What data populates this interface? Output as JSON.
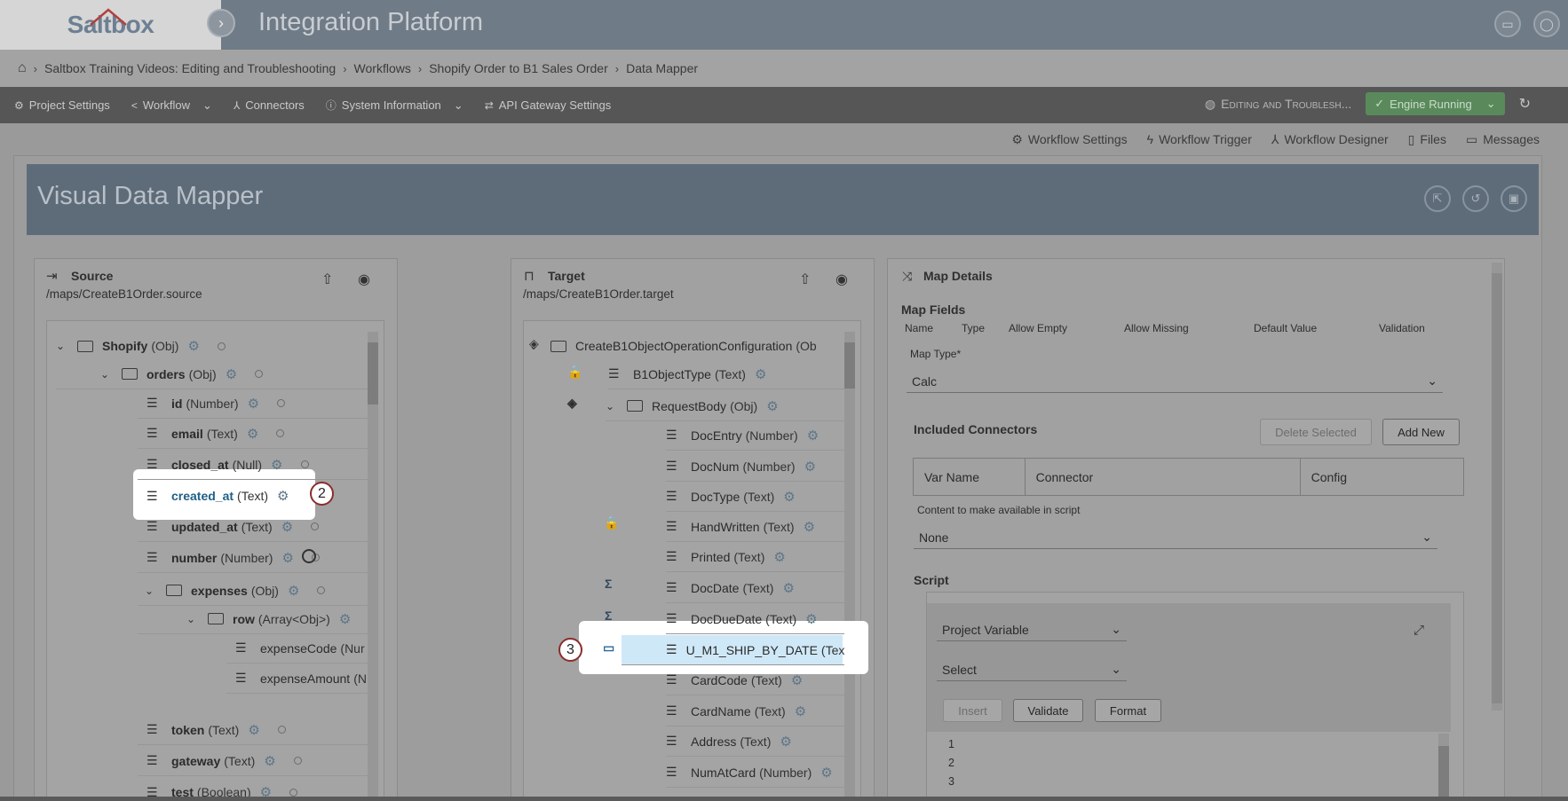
{
  "header": {
    "logo": "Saltbox",
    "title": "Integration Platform"
  },
  "breadcrumb": [
    "Saltbox Training Videos: Editing and Troubleshooting",
    "Workflows",
    "Shopify Order to B1 Sales Order",
    "Data Mapper"
  ],
  "toolbar": {
    "project_settings": "Project Settings",
    "workflow": "Workflow",
    "connectors": "Connectors",
    "system_information": "System Information",
    "api_gateway": "API Gateway Settings",
    "project_name": "Editing and Troublesh...",
    "engine_status": "Engine Running"
  },
  "subbar": {
    "workflow_settings": "Workflow Settings",
    "workflow_trigger": "Workflow Trigger",
    "workflow_designer": "Workflow Designer",
    "files": "Files",
    "messages": "Messages"
  },
  "page_title": "Visual Data Mapper",
  "source": {
    "title": "Source",
    "path": "/maps/CreateB1Order.source",
    "rows": [
      {
        "name": "Shopify",
        "type": "(Obj)"
      },
      {
        "name": "orders",
        "type": "(Obj)"
      },
      {
        "name": "id",
        "type": "(Number)"
      },
      {
        "name": "email",
        "type": "(Text)"
      },
      {
        "name": "closed_at",
        "type": "(Null)"
      },
      {
        "name": "created_at",
        "type": "(Text)"
      },
      {
        "name": "updated_at",
        "type": "(Text)"
      },
      {
        "name": "number",
        "type": "(Number)"
      },
      {
        "name": "expenses",
        "type": "(Obj)"
      },
      {
        "name": "row",
        "type": "(Array<Obj>)"
      },
      {
        "name": "expenseCode",
        "type": "(Nur"
      },
      {
        "name": "expenseAmount",
        "type": "(N"
      },
      {
        "name": "token",
        "type": "(Text)"
      },
      {
        "name": "gateway",
        "type": "(Text)"
      },
      {
        "name": "test",
        "type": "(Boolean)"
      }
    ]
  },
  "target": {
    "title": "Target",
    "path": "/maps/CreateB1Order.target",
    "rows": [
      {
        "name": "CreateB1ObjectOperationConfiguration",
        "type": "(Ob"
      },
      {
        "name": "B1ObjectType",
        "type": "(Text)"
      },
      {
        "name": "RequestBody",
        "type": "(Obj)"
      },
      {
        "name": "DocEntry",
        "type": "(Number)"
      },
      {
        "name": "DocNum",
        "type": "(Number)"
      },
      {
        "name": "DocType",
        "type": "(Text)"
      },
      {
        "name": "HandWritten",
        "type": "(Text)"
      },
      {
        "name": "Printed",
        "type": "(Text)"
      },
      {
        "name": "DocDate",
        "type": "(Text)"
      },
      {
        "name": "DocDueDate",
        "type": "(Text)"
      },
      {
        "name": "U_M1_SHIP_BY_DATE",
        "type": "(Tex"
      },
      {
        "name": "CardCode",
        "type": "(Text)"
      },
      {
        "name": "CardName",
        "type": "(Text)"
      },
      {
        "name": "Address",
        "type": "(Text)"
      },
      {
        "name": "NumAtCard",
        "type": "(Number)"
      }
    ]
  },
  "map_details": {
    "title": "Map Details",
    "map_fields": "Map Fields",
    "columns": [
      "Name",
      "Type",
      "Allow Empty",
      "Allow Missing",
      "Default Value",
      "Validation"
    ],
    "map_type_label": "Map Type*",
    "map_type_value": "Calc",
    "included_connectors": "Included Connectors",
    "delete_selected": "Delete Selected",
    "add_new": "Add New",
    "table_headers": [
      "Var Name",
      "Connector",
      "Config"
    ],
    "content_label": "Content to make available in script",
    "content_value": "None",
    "script_label": "Script",
    "project_variable": "Project Variable",
    "select": "Select",
    "insert": "Insert",
    "validate": "Validate",
    "format": "Format",
    "line_numbers": [
      "1",
      "2",
      "3"
    ]
  },
  "callouts": {
    "one": "2",
    "two": "3"
  }
}
